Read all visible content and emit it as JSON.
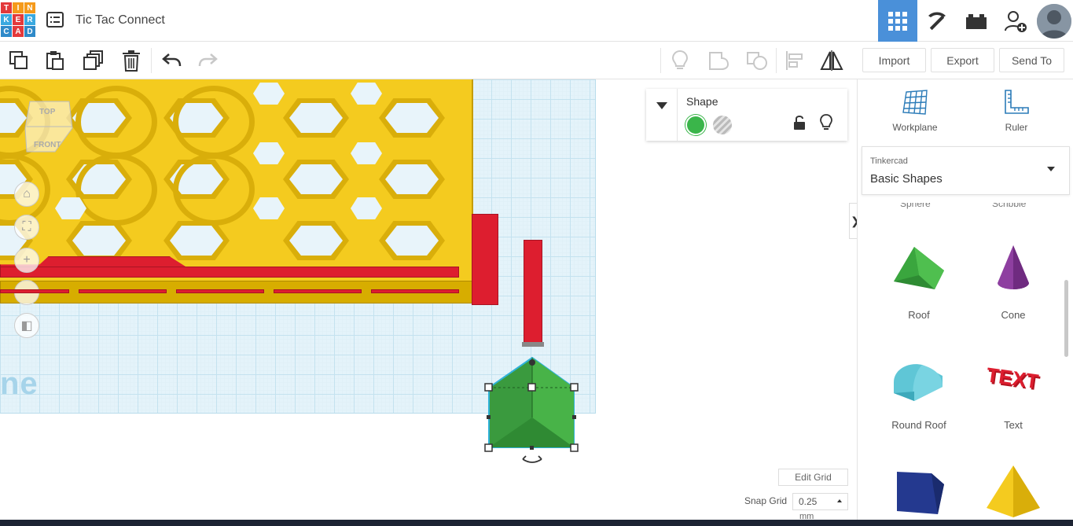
{
  "app": {
    "logo_letters": [
      "T",
      "I",
      "N",
      "K",
      "E",
      "R",
      "C",
      "A",
      "D"
    ],
    "logo_colors": [
      "#e3393b",
      "#f59a1b",
      "#f59a1b",
      "#3aa9e0",
      "#e3393b",
      "#3aa9e0",
      "#2f8ac9",
      "#e3393b",
      "#2f8ac9"
    ],
    "title": "Tic Tac Connect"
  },
  "topnav": {
    "items": [
      {
        "icon": "grid-view-icon",
        "active": true
      },
      {
        "icon": "pickaxe-icon",
        "active": false
      },
      {
        "icon": "bricks-icon",
        "active": false
      },
      {
        "icon": "add-user-icon",
        "active": false
      },
      {
        "icon": "avatar-icon",
        "active": false
      }
    ]
  },
  "toolbar": {
    "actions": [
      "copy-icon",
      "paste-icon",
      "duplicate-icon",
      "delete-icon",
      "undo-icon",
      "redo-icon"
    ],
    "view_actions": [
      "light-bulb-icon",
      "group-icon",
      "ungroup-icon",
      "align-icon",
      "mirror-icon"
    ],
    "import_label": "Import",
    "export_label": "Export",
    "send_to_label": "Send To"
  },
  "viewcube": {
    "top_label": "TOP",
    "front_label": "FRONT"
  },
  "view_controls": [
    "home-icon",
    "fit-icon",
    "zoom-in-icon",
    "zoom-out-icon",
    "perspective-icon"
  ],
  "inspector": {
    "title": "Shape",
    "solid_color": "#3ab54a"
  },
  "grid_controls": {
    "edit_grid_label": "Edit Grid",
    "snap_grid_label": "Snap Grid",
    "snap_value": "0.25",
    "snap_unit": "mm"
  },
  "workplane": {
    "watermark": "ne"
  },
  "right_panel": {
    "workplane_label": "Workplane",
    "ruler_label": "Ruler",
    "library_category": "Tinkercad",
    "library_name": "Basic Shapes",
    "cut_labels": [
      "Sphere",
      "Scribble"
    ],
    "shapes": [
      {
        "label": "Roof",
        "icon": "roof-shape-icon",
        "color": "#3ab54a"
      },
      {
        "label": "Cone",
        "icon": "cone-shape-icon",
        "color": "#8e3fa0"
      },
      {
        "label": "Round Roof",
        "icon": "round-roof-shape-icon",
        "color": "#5fc6d6"
      },
      {
        "label": "Text",
        "icon": "text-shape-icon",
        "color": "#dd1e2f",
        "glyph_text": "TEXT"
      },
      {
        "label": "",
        "icon": "polygon-shape-icon",
        "color": "#24398f"
      },
      {
        "label": "",
        "icon": "pyramid-shape-icon",
        "color": "#f4cb1f"
      }
    ]
  },
  "colors": {
    "accent": "#4a90d9",
    "board_yellow": "#f4cb1f",
    "part_red": "#dd1e2f",
    "selection_green": "#3ab54a",
    "grid_blue": "#e4f3fa"
  }
}
